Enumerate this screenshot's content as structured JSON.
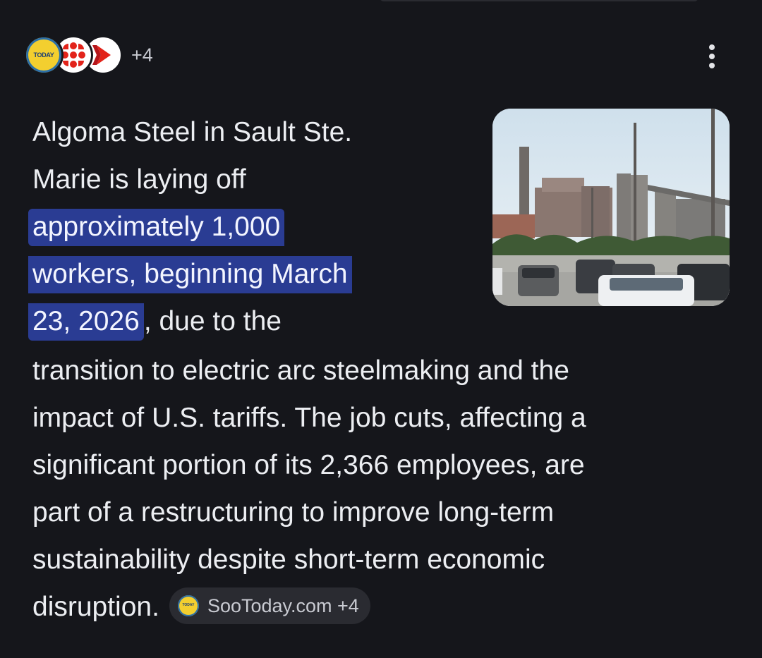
{
  "sources": {
    "logos": [
      {
        "name": "SooToday",
        "icon": "sootoday-logo",
        "text": "TODAY"
      },
      {
        "name": "CBC",
        "icon": "cbc-logo"
      },
      {
        "name": "CTV",
        "icon": "ctv-logo"
      }
    ],
    "more_count": "+4",
    "menu_icon": "more-vert-icon"
  },
  "thumbnail": {
    "alt": "Algoma Steel plant with parking lot",
    "icon": "steel-plant-photo"
  },
  "paragraph": {
    "lines_wrapped": [
      "Algoma Steel in Sault Ste.",
      "Marie is laying off"
    ],
    "highlight_lines": [
      "approximately 1,000",
      "workers, beginning March",
      "23, 2026"
    ],
    "after_highlight": ", due to the",
    "full_lines": [
      "transition to electric arc steelmaking and the",
      "impact of U.S. tariffs. The job cuts, affecting a",
      "significant portion of its 2,366 employees, are",
      "part of a restructuring to improve long-term",
      "sustainability despite short-term economic"
    ],
    "last_line": "disruption."
  },
  "citation_chip": {
    "logo_text": "TODAY",
    "label": "SooToday.com +4"
  },
  "colors": {
    "background": "#15161b",
    "highlight": "#2a3c93",
    "chip_background": "#2a2b31",
    "text": "#eceef2"
  }
}
